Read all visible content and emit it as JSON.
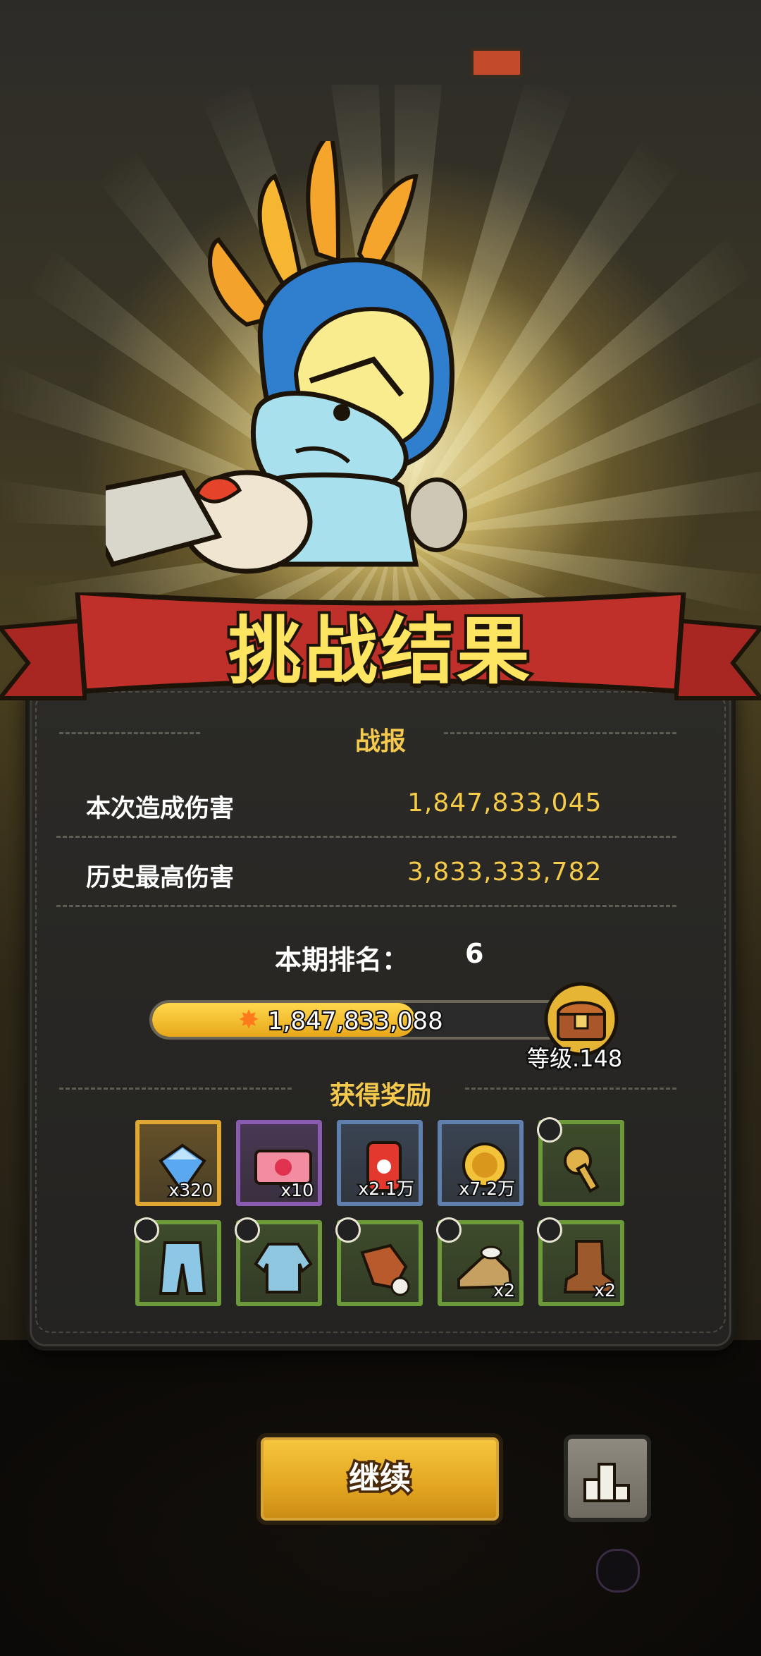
{
  "banner": {
    "title": "挑战结果"
  },
  "report": {
    "title": "战报",
    "rows": [
      {
        "label": "本次造成伤害",
        "value": "1,847,833,045"
      },
      {
        "label": "历史最高伤害",
        "value": "3,833,333,782"
      }
    ]
  },
  "rank": {
    "label": "本期排名：",
    "value": "6"
  },
  "progress": {
    "value_text": "1,847,833,088",
    "fill_fraction": 0.62,
    "level_text": "等级.148"
  },
  "rewards": {
    "title": "获得奖励",
    "items": [
      {
        "icon": "diamond-icon",
        "qty": "x320",
        "rarity": "gold"
      },
      {
        "icon": "ticket-icon",
        "qty": "x10",
        "rarity": "purple"
      },
      {
        "icon": "soda-can-icon",
        "qty": "x2.1万",
        "rarity": "blue"
      },
      {
        "icon": "gold-coin-icon",
        "qty": "x7.2万",
        "rarity": "blue"
      },
      {
        "icon": "windup-key-icon",
        "qty": "",
        "rarity": "green"
      },
      {
        "icon": "pants-icon",
        "qty": "",
        "rarity": "green"
      },
      {
        "icon": "sweater-icon",
        "qty": "",
        "rarity": "green"
      },
      {
        "icon": "glove-icon",
        "qty": "",
        "rarity": "green"
      },
      {
        "icon": "sneaker-icon",
        "qty": "x2",
        "rarity": "green"
      },
      {
        "icon": "boot-icon",
        "qty": "x2",
        "rarity": "green"
      }
    ]
  },
  "buttons": {
    "continue": "继续",
    "ranking_icon": "podium-icon"
  },
  "colors": {
    "gold_text": "#f6cb4a",
    "banner_red": "#c0302a",
    "panel": "#252422",
    "rarity_green": "#6c9a3a",
    "rarity_blue": "#5f7fae",
    "rarity_purple": "#8a5cb1",
    "rarity_gold": "#e0a733"
  }
}
